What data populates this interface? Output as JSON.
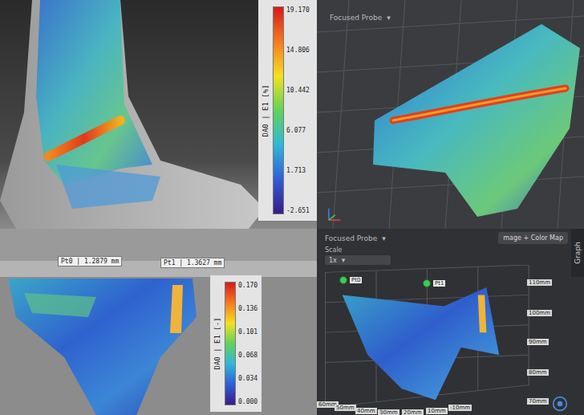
{
  "panels": {
    "ankle_view": {
      "colorbar": {
        "title": "DA0 | E1 [%]",
        "ticks": [
          "19.170",
          "14.806",
          "10.442",
          "6.077",
          "1.713",
          "-2.651"
        ]
      }
    },
    "ankle_3d": {
      "probe_dropdown": {
        "label": "Focused Probe",
        "arrow": "▾"
      }
    },
    "knee_view": {
      "probes": [
        {
          "label": "Pt0 | 1.2879 mm"
        },
        {
          "label": "Pt1 | 1.3627 mm"
        }
      ],
      "colorbar": {
        "title": "DA0 | E1 [-]",
        "ticks": [
          "0.170",
          "0.136",
          "0.101",
          "0.068",
          "0.034",
          "0.000"
        ]
      }
    },
    "knee_3d": {
      "probe_dropdown": {
        "label": "Focused Probe",
        "arrow": "▾"
      },
      "scale": {
        "label": "Scale",
        "value": "1x",
        "arrow": "▾"
      },
      "display_mode": "mage + Color Map",
      "side_tab": "Graph",
      "markers": [
        "Pt0",
        "Pt1"
      ],
      "axis_ticks_vertical": [
        "110mm",
        "100mm",
        "90mm",
        "80mm",
        "70mm"
      ],
      "axis_ticks_horizontal": [
        "60mm",
        "50mm",
        "40mm",
        "30mm",
        "20mm",
        "10mm",
        "-10mm"
      ]
    }
  }
}
